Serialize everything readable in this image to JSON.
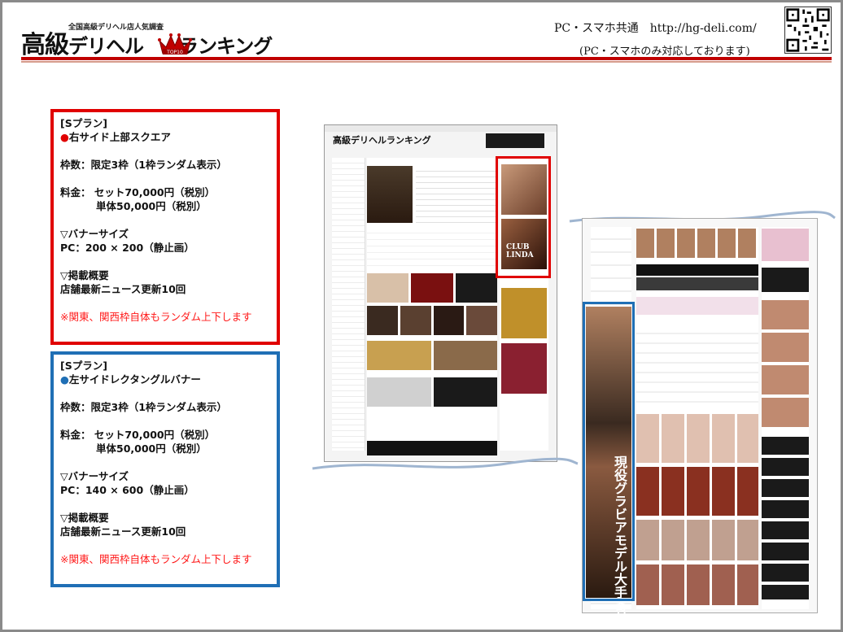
{
  "header": {
    "logo_sub": "全国高級デリヘル店人気調査",
    "logo_main_1": "高級",
    "logo_main_2": "デリヘル",
    "logo_badge": "TOP10",
    "logo_main_3": "ランキング",
    "site_line": "PC・スマホ共通　http://hg-deli.com/",
    "site_note": "(PC・スマホのみ対応しております)"
  },
  "plans": [
    {
      "title": "[Sプラン]",
      "name": "右サイド上部スクエア",
      "slots": "枠数：限定3枠（1枠ランダム表示）",
      "price_set": "料金：  セット70,000円（税別）",
      "price_single": "単体50,000円（税別）",
      "size_head": "▽バナーサイズ",
      "size_value": "PC：200 × 200（静止画）",
      "content_head": "▽掲載概要",
      "content_value": "店舗最新ニュース更新10回",
      "note": "※関東、関西枠自体もランダム上下します"
    },
    {
      "title": "[Sプラン]",
      "name": "左サイドレクタングルバナー",
      "slots": "枠数：限定3枠（1枠ランダム表示）",
      "price_set": "料金：  セット70,000円（税別）",
      "price_single": "単体50,000円（税別）",
      "size_head": "▽バナーサイズ",
      "size_value": "PC：140 × 600（静止画）",
      "content_head": "▽掲載概要",
      "content_value": "店舗最新ニュース更新10回",
      "note": "※関東、関西枠自体もランダム上下します"
    }
  ],
  "mock1": {
    "title": "高級デリヘルランキング",
    "banner_text": "CLUB LINDA"
  },
  "mock2": {
    "vertical_text": "現役グラビアモデル大手寄付"
  },
  "colors": {
    "red_frame": "#e00000",
    "blue_frame": "#1f6fb5",
    "header_rule": "#c00000"
  }
}
